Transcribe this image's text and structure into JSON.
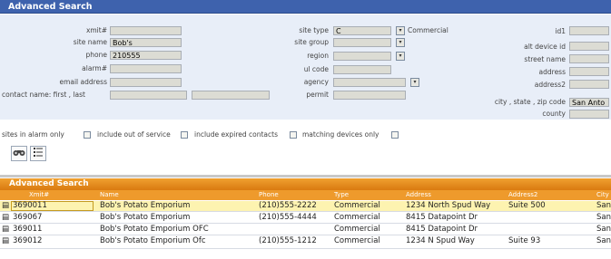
{
  "header": {
    "title": "Advanced Search"
  },
  "form": {
    "labels": {
      "xmit": "xmit#",
      "site_name": "site name",
      "phone": "phone",
      "alarm": "alarm#",
      "email": "email address",
      "contact": "contact name: first , last",
      "site_type": "site type",
      "site_group": "site group",
      "region": "region",
      "ul_code": "ul code",
      "agency": "agency",
      "permit": "permit",
      "id1": "id1",
      "alt_device_id": "alt device id",
      "street_name": "street name",
      "address": "address",
      "address2": "address2",
      "city_state_zip": "city , state , zip code",
      "county": "county"
    },
    "values": {
      "xmit": "",
      "site_name": "Bob's",
      "phone": "210555",
      "alarm": "",
      "email": "",
      "contact_first": "",
      "contact_last": "",
      "site_type": "C",
      "site_type_desc": "Commercial",
      "site_group": "",
      "region": "",
      "ul_code": "",
      "agency": "",
      "permit": "",
      "id1": "",
      "alt_device_id": "",
      "street_name": "",
      "address": "",
      "address2": "",
      "city": "San Anto",
      "county": ""
    }
  },
  "options": {
    "sites_in_alarm": "sites in alarm only",
    "include_out_of_service": "include out of service",
    "include_expired_contacts": "include expired contacts",
    "matching_devices_only": "matching devices only"
  },
  "results": {
    "title": "Advanced Search",
    "columns": [
      "Xmit#",
      "Name",
      "Phone",
      "Type",
      "Address",
      "Address2",
      "City"
    ],
    "rows": [
      {
        "xmit": "3690011",
        "name": "Bob's Potato Emporium",
        "phone": "(210)555-2222",
        "type": "Commercial",
        "address": "1234 North Spud Way",
        "address2": "Suite 500",
        "city": "San"
      },
      {
        "xmit": "369067",
        "name": "Bob's Potato Emporium",
        "phone": "(210)555-4444",
        "type": "Commercial",
        "address": "8415 Datapoint Dr",
        "address2": "",
        "city": "San"
      },
      {
        "xmit": "369011",
        "name": "Bob's Potato Emporium OFC",
        "phone": "",
        "type": "Commercial",
        "address": "8415 Datapoint Dr",
        "address2": "",
        "city": "San"
      },
      {
        "xmit": "369012",
        "name": "Bob's Potato Emporium Ofc",
        "phone": "(210)555-1212",
        "type": "Commercial",
        "address": "1234 N Spud Way",
        "address2": "Suite 93",
        "city": "San"
      }
    ]
  },
  "colors": {
    "title_bar": "#3e62ad",
    "results_bar": "#e58a1c",
    "selected_row": "#fdf3b0"
  }
}
